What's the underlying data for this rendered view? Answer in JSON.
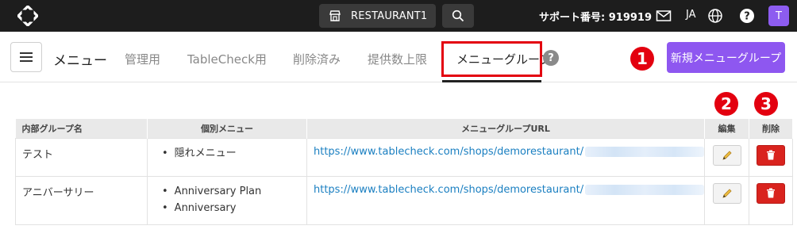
{
  "topbar": {
    "store_name": "RESTAURANT1",
    "support_label": "サポート番号: 919919",
    "language": "JA",
    "avatar_initial": "T",
    "icons": [
      "logo-icon",
      "store-icon",
      "search-icon",
      "mail-icon",
      "globe-icon",
      "help-icon"
    ]
  },
  "tabbar": {
    "title": "メニュー",
    "tabs": [
      {
        "label": "管理用"
      },
      {
        "label": "TableCheck用"
      },
      {
        "label": "削除済み"
      },
      {
        "label": "提供数上限"
      },
      {
        "label": "メニューグループ",
        "active": true
      }
    ],
    "help_glyph": "?",
    "new_button_label": "新規メニューグループ"
  },
  "markers": {
    "one": "1",
    "two": "2",
    "three": "3"
  },
  "table": {
    "headers": {
      "name": "内部グループ名",
      "items": "個別メニュー",
      "url": "メニューグループURL",
      "edit": "編集",
      "delete": "削除"
    },
    "rows": [
      {
        "name": "テスト",
        "items": [
          "隠れメニュー"
        ],
        "url": "https://www.tablecheck.com/shops/demorestaurant/"
      },
      {
        "name": "アニバーサリー",
        "items": [
          "Anniversary Plan",
          "Anniversary"
        ],
        "url": "https://www.tablecheck.com/shops/demorestaurant/"
      }
    ]
  },
  "colors": {
    "topbar": "#1d1d1d",
    "accent_purple": "#8e57f0",
    "highlight_red": "#e3000f",
    "delete_red": "#d9231e",
    "link_blue": "#1a7fc1"
  }
}
